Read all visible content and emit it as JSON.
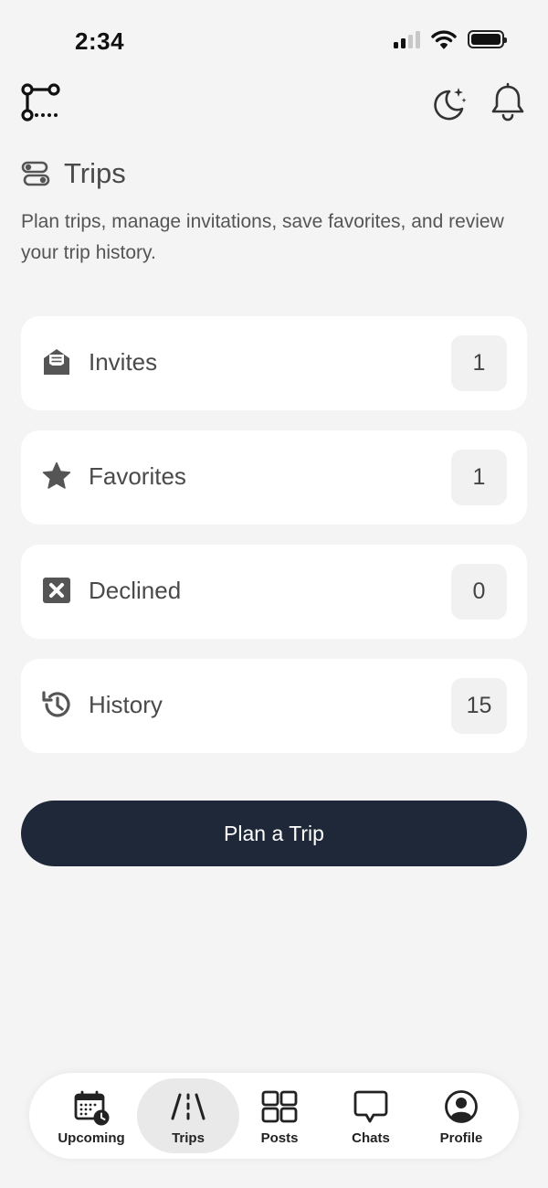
{
  "status_bar": {
    "time": "2:34"
  },
  "header": {
    "logo_icon": "route-icon",
    "theme_icon": "moon-stars-icon",
    "notifications_icon": "bell-icon"
  },
  "page": {
    "title": "Trips",
    "title_icon": "sliders-route-icon",
    "description": "Plan trips, manage invitations, save favorites, and review your trip history."
  },
  "cards": [
    {
      "label": "Invites",
      "count": "1",
      "icon": "envelope-open-icon"
    },
    {
      "label": "Favorites",
      "count": "1",
      "icon": "star-icon"
    },
    {
      "label": "Declined",
      "count": "0",
      "icon": "x-square-icon"
    },
    {
      "label": "History",
      "count": "15",
      "icon": "history-icon"
    }
  ],
  "primary_action": {
    "label": "Plan a Trip"
  },
  "bottom_nav": {
    "active": "Trips",
    "items": [
      {
        "label": "Upcoming",
        "icon": "calendar-clock-icon"
      },
      {
        "label": "Trips",
        "icon": "road-icon"
      },
      {
        "label": "Posts",
        "icon": "grid-icon"
      },
      {
        "label": "Chats",
        "icon": "chat-bubble-icon"
      },
      {
        "label": "Profile",
        "icon": "user-circle-icon"
      }
    ]
  },
  "colors": {
    "background": "#f4f4f4",
    "card": "#ffffff",
    "primary_button": "#1f2839",
    "text_muted": "#4a4a4a"
  }
}
